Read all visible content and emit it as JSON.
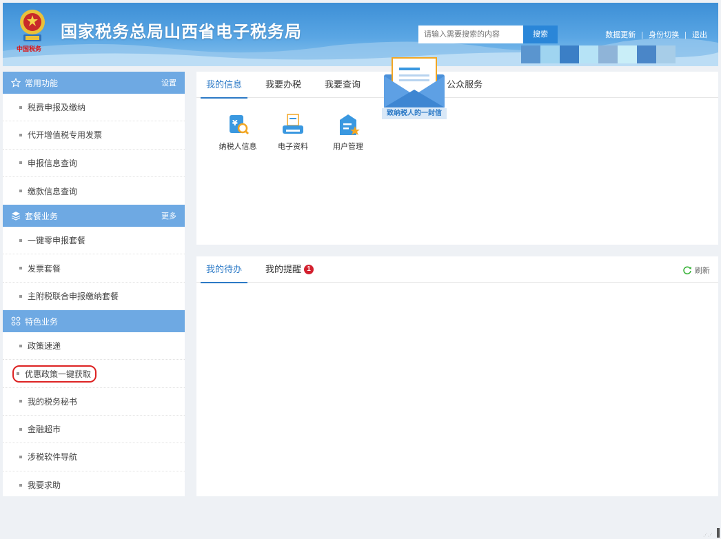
{
  "header": {
    "title": "国家税务总局山西省电子税务局",
    "emblem_caption": "中国税务",
    "search_placeholder": "请输入需要搜索的内容",
    "search_button": "搜索",
    "links": [
      "数据更新",
      "身份切换",
      "退出"
    ],
    "colors": {
      "accent": "#2a86d8",
      "header_bg": "#4a9ad9"
    }
  },
  "sidebar": {
    "sections": [
      {
        "title": "常用功能",
        "action": "设置",
        "icon": "star-outline-icon",
        "items": [
          "税费申报及缴纳",
          "代开增值税专用发票",
          "申报信息查询",
          "缴款信息查询"
        ]
      },
      {
        "title": "套餐业务",
        "action": "更多",
        "icon": "layers-icon",
        "items": [
          "一键零申报套餐",
          "发票套餐",
          "主附税联合申报缴纳套餐"
        ]
      },
      {
        "title": "特色业务",
        "action": "",
        "icon": "grid-icon",
        "items": [
          "政策速递",
          "优惠政策一键获取",
          "我的税务秘书",
          "金融超市",
          "涉税软件导航",
          "我要求助"
        ]
      }
    ]
  },
  "top_panel": {
    "tabs": [
      "我的信息",
      "我要办税",
      "我要查询",
      "互动中心",
      "公众服务"
    ],
    "tab_visible": [
      "我的信息",
      "我要办税",
      "我要查询",
      "互",
      "公众服务"
    ],
    "tiles": [
      {
        "label": "纳税人信息",
        "icon": "taxpayer-info-icon"
      },
      {
        "label": "电子资料",
        "icon": "electronic-docs-icon"
      },
      {
        "label": "用户管理",
        "icon": "user-management-icon"
      }
    ]
  },
  "letter": {
    "label": "致纳税人的一封信",
    "icon": "envelope-icon"
  },
  "bottom_panel": {
    "tabs": [
      "我的待办",
      "我的提醒"
    ],
    "reminder_count": "1",
    "refresh_label": "刷新"
  }
}
